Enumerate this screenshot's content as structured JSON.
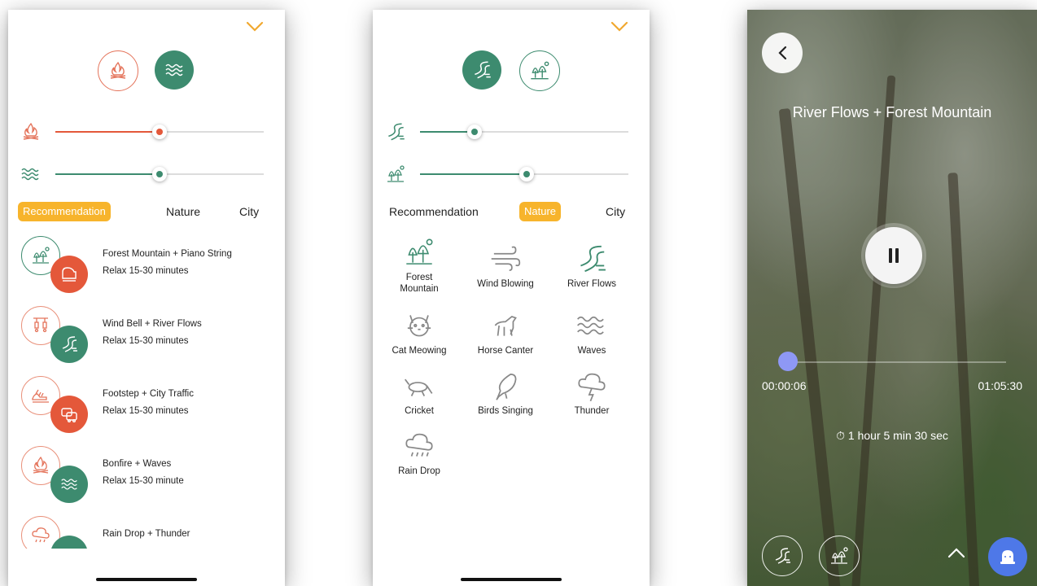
{
  "colors": {
    "accent_orange": "#e4583a",
    "accent_green": "#3d8b6f",
    "tab_active": "#f7b42c",
    "progress_thumb": "#8e98f5",
    "alarm_button": "#4e78e8"
  },
  "screen1": {
    "collapse_icon": "chevron-down-icon",
    "top_sounds": [
      {
        "icon": "bonfire-icon",
        "active": false
      },
      {
        "icon": "waves-icon",
        "active": true
      }
    ],
    "sliders": [
      {
        "icon": "bonfire-icon",
        "value_fraction": 0.5,
        "color": "#e4583a"
      },
      {
        "icon": "waves-icon",
        "value_fraction": 0.5,
        "color": "#3d8b6f"
      }
    ],
    "tabs": [
      "Recommendation",
      "Nature",
      "City"
    ],
    "active_tab": "Recommendation",
    "recommendations": [
      {
        "title": "Forest Mountain + Piano String",
        "subtitle": "Relax 15-30 minutes"
      },
      {
        "title": "Wind Bell + River Flows",
        "subtitle": "Relax 15-30 minutes"
      },
      {
        "title": "Footstep + City Traffic",
        "subtitle": "Relax 15-30 minutes"
      },
      {
        "title": "Bonfire + Waves",
        "subtitle": "Relax 15-30 minute"
      },
      {
        "title": "Rain Drop + Thunder",
        "subtitle": ""
      }
    ]
  },
  "screen2": {
    "collapse_icon": "chevron-down-icon",
    "top_sounds": [
      {
        "icon": "river-flows-icon",
        "active": true
      },
      {
        "icon": "forest-mountain-icon",
        "active": false
      }
    ],
    "sliders": [
      {
        "icon": "river-flows-icon",
        "value_fraction": 0.26,
        "color": "#3d8b6f"
      },
      {
        "icon": "forest-mountain-icon",
        "value_fraction": 0.51,
        "color": "#3d8b6f"
      }
    ],
    "tabs": [
      "Recommendation",
      "Nature",
      "City"
    ],
    "active_tab": "Nature",
    "sounds": [
      {
        "label_lines": [
          "Forest",
          "Mountain"
        ],
        "icon": "forest-mountain-icon"
      },
      {
        "label_lines": [
          "Wind Blowing"
        ],
        "icon": "wind-icon"
      },
      {
        "label_lines": [
          "River Flows"
        ],
        "icon": "river-flows-icon"
      },
      {
        "label_lines": [
          "Cat Meowing"
        ],
        "icon": "cat-icon"
      },
      {
        "label_lines": [
          "Horse Canter"
        ],
        "icon": "horse-icon"
      },
      {
        "label_lines": [
          "Waves"
        ],
        "icon": "waves-icon"
      },
      {
        "label_lines": [
          "Cricket"
        ],
        "icon": "cricket-icon"
      },
      {
        "label_lines": [
          "Birds Singing"
        ],
        "icon": "bird-icon"
      },
      {
        "label_lines": [
          "Thunder"
        ],
        "icon": "thunder-icon"
      },
      {
        "label_lines": [
          "Rain Drop"
        ],
        "icon": "rain-icon"
      }
    ]
  },
  "player": {
    "title": "River Flows + Forest Mountain",
    "elapsed": "00:00:06",
    "total": "01:05:30",
    "progress_fraction": 0.01,
    "timer_text": "⏱ 1 hour 5 min 30 sec",
    "bottom_sounds": [
      "river-flows-icon",
      "forest-mountain-icon"
    ]
  }
}
